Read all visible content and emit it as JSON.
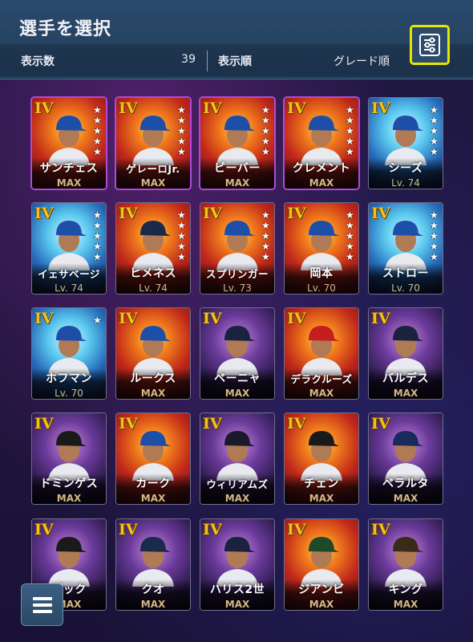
{
  "header": {
    "title": "選手を選択",
    "count_label": "表示数",
    "count_value": "39",
    "order_label": "表示順",
    "order_value": "グレード順"
  },
  "colors": {
    "grade_gold": "#f4c21b",
    "filter_highlight": "#e6e600",
    "header_bg": "#2a4a6c"
  },
  "icons": {
    "filter": "filter-settings-icon",
    "menu": "hamburger-menu-icon"
  },
  "players": [
    {
      "name": "サンチェス",
      "level": "MAX",
      "grade": "IV",
      "stars": 5,
      "frame": "purple",
      "cap": "#1e4fa8",
      "bg": "fire"
    },
    {
      "name": "ゲレーロJr.",
      "level": "MAX",
      "grade": "IV",
      "stars": 5,
      "frame": "purple",
      "cap": "#1e4fa8",
      "bg": "fire"
    },
    {
      "name": "ビーバー",
      "level": "MAX",
      "grade": "IV",
      "stars": 5,
      "frame": "purple",
      "cap": "#1e4fa8",
      "bg": "fire"
    },
    {
      "name": "クレメント",
      "level": "MAX",
      "grade": "IV",
      "stars": 5,
      "frame": "purple",
      "cap": "#1e4fa8",
      "bg": "fire"
    },
    {
      "name": "シーズ",
      "level": "Lv. 74",
      "grade": "IV",
      "stars": 5,
      "frame": "plain",
      "cap": "#1e4fa8",
      "bg": "ice"
    },
    {
      "name": "イェサベージ",
      "level": "Lv. 74",
      "grade": "IV",
      "stars": 5,
      "frame": "plain",
      "cap": "#1e4fa8",
      "bg": "ice"
    },
    {
      "name": "ヒメネス",
      "level": "Lv. 74",
      "grade": "IV",
      "stars": 5,
      "frame": "plain",
      "cap": "#1a2a4a",
      "bg": "fire"
    },
    {
      "name": "スプリンガー",
      "level": "Lv. 73",
      "grade": "IV",
      "stars": 5,
      "frame": "plain",
      "cap": "#1e4fa8",
      "bg": "fire"
    },
    {
      "name": "岡本",
      "level": "Lv. 70",
      "grade": "IV",
      "stars": 5,
      "frame": "plain",
      "cap": "#1e4fa8",
      "bg": "fire"
    },
    {
      "name": "ストロー",
      "level": "Lv. 70",
      "grade": "IV",
      "stars": 5,
      "frame": "plain",
      "cap": "#1e4fa8",
      "bg": "ice"
    },
    {
      "name": "ホフマン",
      "level": "Lv. 70",
      "grade": "IV",
      "stars": 1,
      "frame": "plain",
      "cap": "#1e4fa8",
      "bg": "ice"
    },
    {
      "name": "ルークス",
      "level": "MAX",
      "grade": "IV",
      "stars": 0,
      "frame": "plain",
      "cap": "#1e4fa8",
      "bg": "fire"
    },
    {
      "name": "ペーニャ",
      "level": "MAX",
      "grade": "IV",
      "stars": 0,
      "frame": "plain",
      "cap": "#1a2240",
      "bg": "dark"
    },
    {
      "name": "デラクルーズ",
      "level": "MAX",
      "grade": "IV",
      "stars": 0,
      "frame": "plain",
      "cap": "#c41e1e",
      "bg": "fire"
    },
    {
      "name": "バルデス",
      "level": "MAX",
      "grade": "IV",
      "stars": 0,
      "frame": "plain",
      "cap": "#1a2240",
      "bg": "dark"
    },
    {
      "name": "ドミンゲス",
      "level": "MAX",
      "grade": "IV",
      "stars": 0,
      "frame": "plain",
      "cap": "#1a1a1a",
      "bg": "dark"
    },
    {
      "name": "カーク",
      "level": "MAX",
      "grade": "IV",
      "stars": 0,
      "frame": "plain",
      "cap": "#1e4fa8",
      "bg": "fire"
    },
    {
      "name": "ウィリアムズ",
      "level": "MAX",
      "grade": "IV",
      "stars": 0,
      "frame": "plain",
      "cap": "#1a1a2a",
      "bg": "dark"
    },
    {
      "name": "チェン",
      "level": "MAX",
      "grade": "IV",
      "stars": 0,
      "frame": "plain",
      "cap": "#1a1a1a",
      "bg": "fire"
    },
    {
      "name": "ペラルタ",
      "level": "MAX",
      "grade": "IV",
      "stars": 0,
      "frame": "plain",
      "cap": "#1a2a5a",
      "bg": "dark"
    },
    {
      "name": "ゲック",
      "level": "MAX",
      "grade": "IV",
      "stars": 0,
      "frame": "plain",
      "cap": "#1a1a1a",
      "bg": "dark"
    },
    {
      "name": "クオ",
      "level": "MAX",
      "grade": "IV",
      "stars": 0,
      "frame": "plain",
      "cap": "#1a2a4a",
      "bg": "dark"
    },
    {
      "name": "ハリス2世",
      "level": "MAX",
      "grade": "IV",
      "stars": 0,
      "frame": "plain",
      "cap": "#1a2240",
      "bg": "dark"
    },
    {
      "name": "ジアンビ",
      "level": "MAX",
      "grade": "IV",
      "stars": 0,
      "frame": "plain",
      "cap": "#1e4a2a",
      "bg": "fire"
    },
    {
      "name": "キング",
      "level": "MAX",
      "grade": "IV",
      "stars": 0,
      "frame": "plain",
      "cap": "#3a2a1a",
      "bg": "dark"
    }
  ]
}
